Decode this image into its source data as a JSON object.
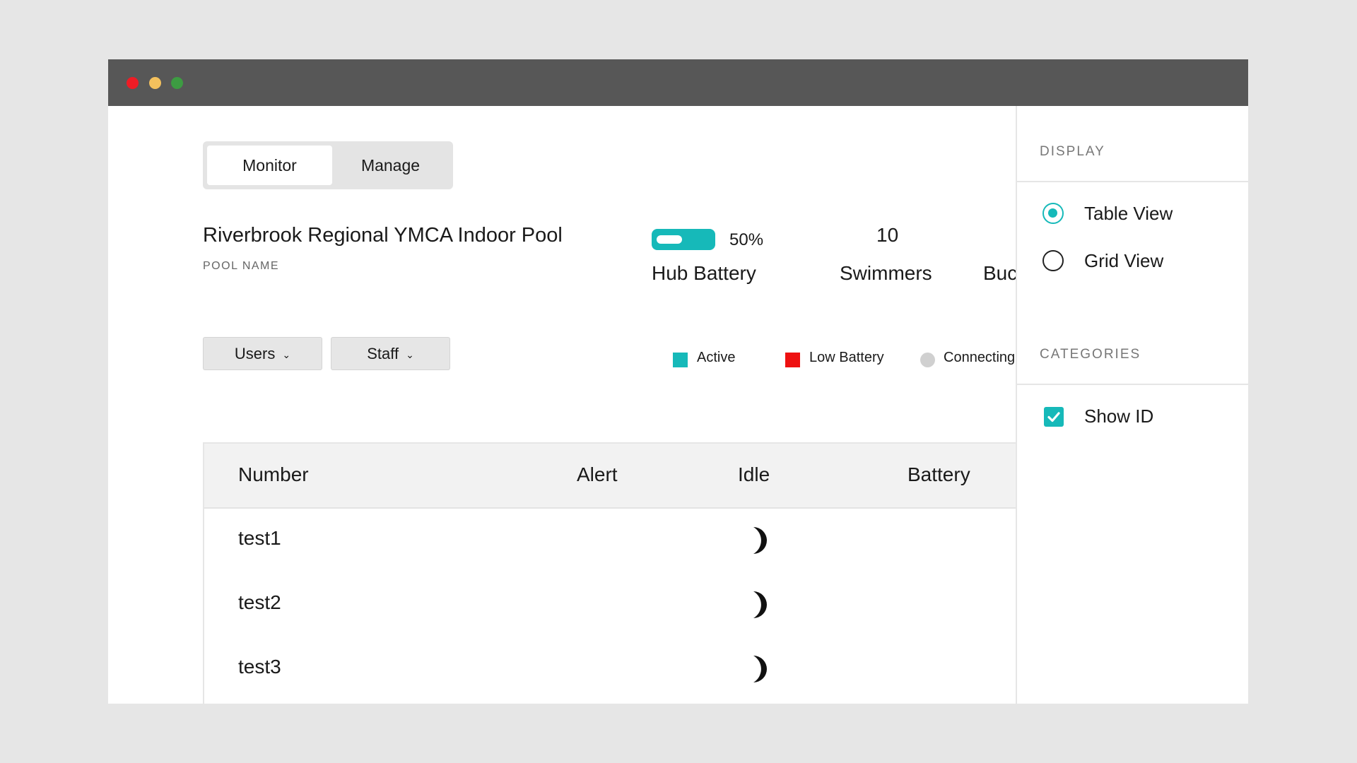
{
  "tabs": {
    "monitor": "Monitor",
    "manage": "Manage"
  },
  "pool": {
    "name": "Riverbrook Regional YMCA Indoor Pool",
    "label": "POOL NAME"
  },
  "stats": {
    "hub_battery_percent": "50%",
    "hub_battery_label": "Hub Battery",
    "swimmers_value": "10",
    "swimmers_label": "Swimmers",
    "buddies_label_partial": "Buc"
  },
  "filters": {
    "users": "Users",
    "staff": "Staff"
  },
  "legend": {
    "active": "Active",
    "low_battery": "Low Battery",
    "connecting": "Connecting"
  },
  "colors": {
    "accent": "#16b9b9",
    "low_battery": "#ee1111",
    "connecting": "#d0d0d0"
  },
  "table": {
    "headers": {
      "number": "Number",
      "alert": "Alert",
      "idle": "Idle",
      "battery": "Battery"
    },
    "rows": [
      {
        "number": "test1",
        "idle_icon": "moon-icon"
      },
      {
        "number": "test2",
        "idle_icon": "moon-icon"
      },
      {
        "number": "test3",
        "idle_icon": "moon-icon"
      }
    ]
  },
  "panel": {
    "display_title": "DISPLAY",
    "table_view": "Table View",
    "grid_view": "Grid View",
    "selected_view": "Table View",
    "categories_title": "CATEGORIES",
    "show_id": "Show ID",
    "show_id_checked": true
  }
}
